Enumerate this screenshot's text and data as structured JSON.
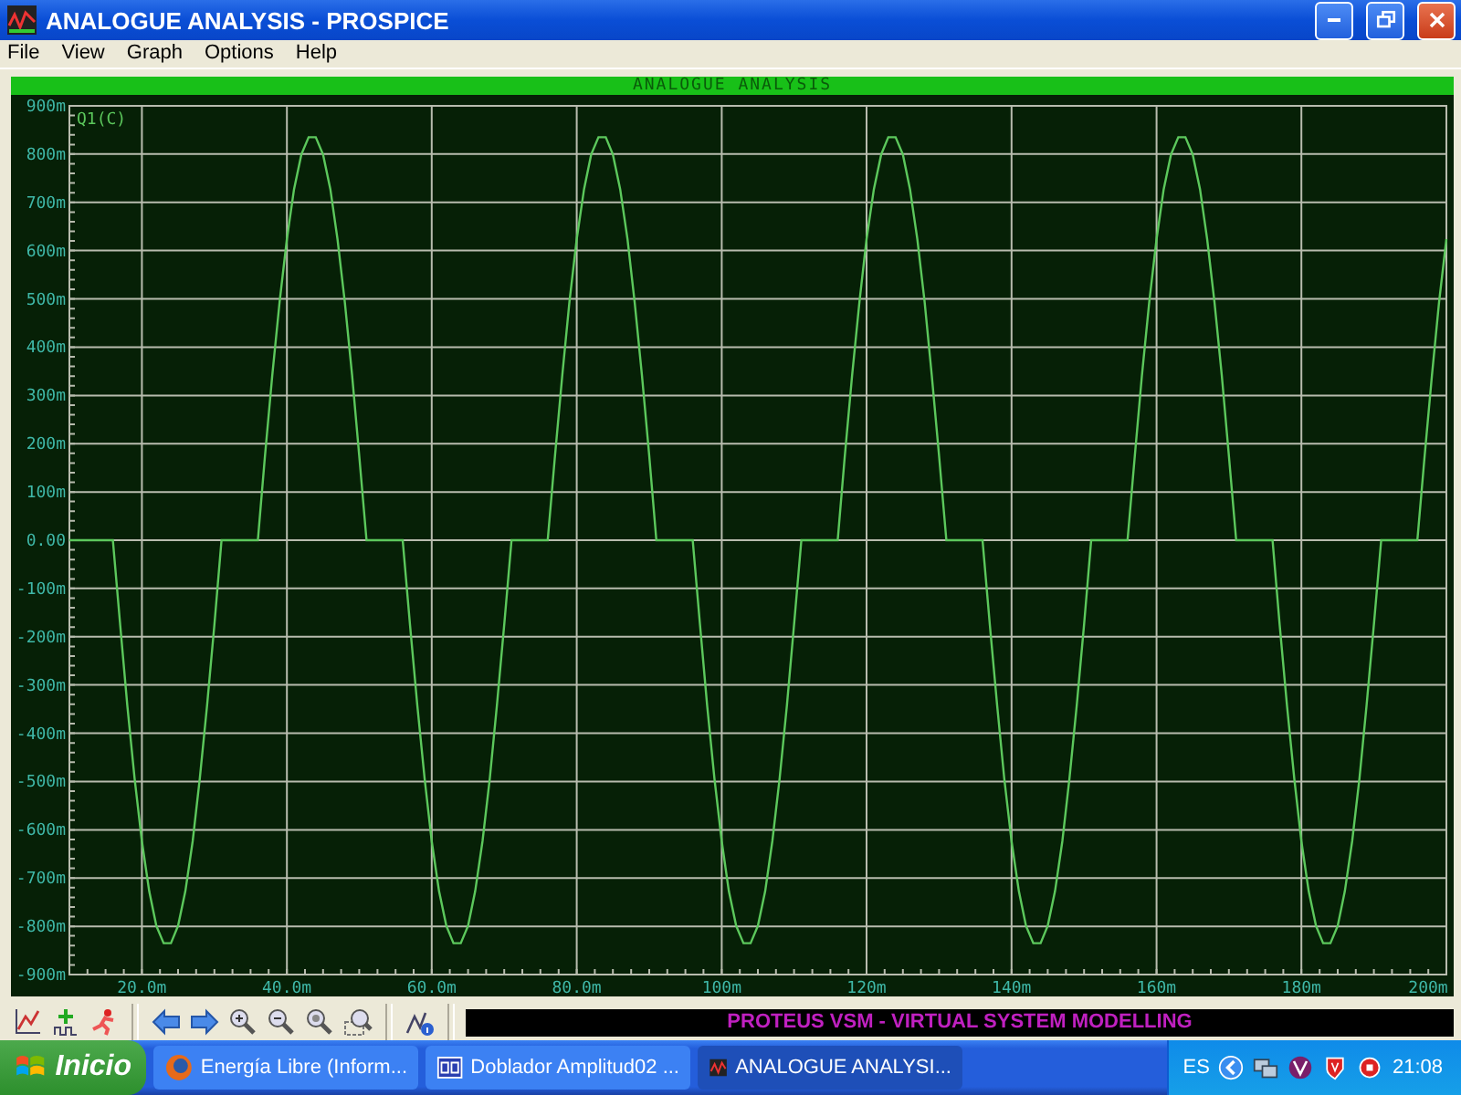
{
  "window": {
    "title": "ANALOGUE ANALYSIS - PROSPICE"
  },
  "menu": [
    "File",
    "View",
    "Graph",
    "Options",
    "Help"
  ],
  "graph": {
    "chart_data": {
      "type": "line",
      "title": "ANALOGUE ANALYSIS",
      "x": [
        10,
        11,
        12,
        13,
        14,
        15,
        16,
        17,
        18,
        19,
        20,
        21,
        22,
        23,
        24,
        25,
        26,
        27,
        28,
        29,
        30,
        31,
        32,
        33,
        34,
        35,
        36,
        37,
        38,
        39,
        40,
        41,
        42,
        43,
        44,
        45,
        46,
        47,
        48,
        49,
        50,
        51,
        52,
        53,
        54,
        55,
        56,
        57,
        58,
        59,
        60,
        61,
        62,
        63,
        64,
        65,
        66,
        67,
        68,
        69,
        70,
        71,
        72,
        73,
        74,
        75,
        76,
        77,
        78,
        79,
        80,
        81,
        82,
        83,
        84,
        85,
        86,
        87,
        88,
        89,
        90,
        91,
        92,
        93,
        94,
        95,
        96,
        97,
        98,
        99,
        100,
        101,
        102,
        103,
        104,
        105,
        106,
        107,
        108,
        109,
        110,
        111,
        112,
        113,
        114,
        115,
        116,
        117,
        118,
        119,
        120,
        121,
        122,
        123,
        124,
        125,
        126,
        127,
        128,
        129,
        130,
        131,
        132,
        133,
        134,
        135,
        136,
        137,
        138,
        139,
        140,
        141,
        142,
        143,
        144,
        145,
        146,
        147,
        148,
        149,
        150,
        151,
        152,
        153,
        154,
        155,
        156,
        157,
        158,
        159,
        160,
        161,
        162,
        163,
        164,
        165,
        166,
        167,
        168,
        169,
        170,
        171,
        172,
        173,
        174,
        175,
        176,
        177,
        178,
        179,
        180,
        181,
        182,
        183,
        184,
        185,
        186,
        187,
        188,
        189,
        190,
        191,
        192,
        193,
        194,
        195,
        196,
        197,
        198,
        199,
        200
      ],
      "series": [
        {
          "name": "Q1(C)",
          "color": "#5cc85c",
          "values": [
            0,
            0,
            0,
            0,
            0,
            0,
            0,
            -175,
            -342,
            -494,
            -624,
            -727,
            -799,
            -835,
            -835,
            -799,
            -727,
            -624,
            -494,
            -342,
            -175,
            0,
            0,
            0,
            0,
            0,
            0,
            175,
            342,
            494,
            624,
            727,
            799,
            835,
            835,
            799,
            727,
            624,
            494,
            342,
            175,
            0,
            0,
            0,
            0,
            0,
            0,
            -175,
            -342,
            -494,
            -624,
            -727,
            -799,
            -835,
            -835,
            -799,
            -727,
            -624,
            -494,
            -342,
            -175,
            0,
            0,
            0,
            0,
            0,
            0,
            175,
            342,
            494,
            624,
            727,
            799,
            835,
            835,
            799,
            727,
            624,
            494,
            342,
            175,
            0,
            0,
            0,
            0,
            0,
            0,
            -175,
            -342,
            -494,
            -624,
            -727,
            -799,
            -835,
            -835,
            -799,
            -727,
            -624,
            -494,
            -342,
            -175,
            0,
            0,
            0,
            0,
            0,
            0,
            175,
            342,
            494,
            624,
            727,
            799,
            835,
            835,
            799,
            727,
            624,
            494,
            342,
            175,
            0,
            0,
            0,
            0,
            0,
            0,
            -175,
            -342,
            -494,
            -624,
            -727,
            -799,
            -835,
            -835,
            -799,
            -727,
            -624,
            -494,
            -342,
            -175,
            0,
            0,
            0,
            0,
            0,
            0,
            175,
            342,
            494,
            624,
            727,
            799,
            835,
            835,
            799,
            727,
            624,
            494,
            342,
            175,
            0,
            0,
            0,
            0,
            0,
            0,
            -175,
            -342,
            -494,
            -624,
            -727,
            -799,
            -835,
            -835,
            -799,
            -727,
            -624,
            -494,
            -342,
            -175,
            0,
            0,
            0,
            0,
            0,
            0,
            175,
            342,
            494,
            624
          ]
        }
      ],
      "xlim": [
        10,
        200
      ],
      "ylim": [
        -900,
        900
      ],
      "grid": true,
      "xticks": [
        {
          "value": 20,
          "label": "20.0m"
        },
        {
          "value": 40,
          "label": "40.0m"
        },
        {
          "value": 60,
          "label": "60.0m"
        },
        {
          "value": 80,
          "label": "80.0m"
        },
        {
          "value": 100,
          "label": "100m"
        },
        {
          "value": 120,
          "label": "120m"
        },
        {
          "value": 140,
          "label": "140m"
        },
        {
          "value": 160,
          "label": "160m"
        },
        {
          "value": 180,
          "label": "180m"
        },
        {
          "value": 200,
          "label": "200m"
        }
      ],
      "yticks": [
        {
          "value": 900,
          "label": "900m"
        },
        {
          "value": 800,
          "label": "800m"
        },
        {
          "value": 700,
          "label": "700m"
        },
        {
          "value": 600,
          "label": "600m"
        },
        {
          "value": 500,
          "label": "500m"
        },
        {
          "value": 400,
          "label": "400m"
        },
        {
          "value": 300,
          "label": "300m"
        },
        {
          "value": 200,
          "label": "200m"
        },
        {
          "value": 100,
          "label": "100m"
        },
        {
          "value": 0,
          "label": "0.00"
        },
        {
          "value": -100,
          "label": "-100m"
        },
        {
          "value": -200,
          "label": "-200m"
        },
        {
          "value": -300,
          "label": "-300m"
        },
        {
          "value": -400,
          "label": "-400m"
        },
        {
          "value": -500,
          "label": "-500m"
        },
        {
          "value": -600,
          "label": "-600m"
        },
        {
          "value": -700,
          "label": "-700m"
        },
        {
          "value": -800,
          "label": "-800m"
        },
        {
          "value": -900,
          "label": "-900m"
        }
      ]
    }
  },
  "status_text": "PROTEUS VSM - VIRTUAL SYSTEM MODELLING",
  "taskbar": {
    "start": "Inicio",
    "tasks": [
      {
        "label": "Energía Libre (Inform...",
        "selected": false
      },
      {
        "label": "Doblador Amplitud02 ...",
        "selected": false
      },
      {
        "label": "ANALOGUE ANALYSI...",
        "selected": true
      }
    ],
    "language": "ES",
    "clock": "21:08"
  }
}
